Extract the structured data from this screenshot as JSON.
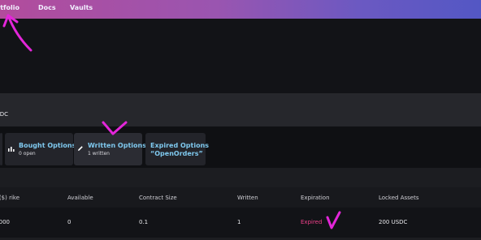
{
  "nav": {
    "portfolio": "Portfolio",
    "docs": "Docs",
    "vaults": "Vaults"
  },
  "account": {
    "text": "DC"
  },
  "tabs": [
    {
      "title": "Bought Options",
      "subtitle": "0 open",
      "icon": "bar-chart-icon"
    },
    {
      "title": "Written Options",
      "subtitle": "1 written",
      "icon": "pencil-icon"
    },
    {
      "title": "Expired Options",
      "subtitle": "“OpenOrders”"
    }
  ],
  "table": {
    "headers": [
      "rike ($)",
      "Available",
      "Contract Size",
      "Written",
      "Expiration",
      "Locked Assets"
    ],
    "rows": [
      {
        "strike": "000",
        "available": "0",
        "contract_size": "0.1",
        "written": "1",
        "expiration": "Expired",
        "locked_assets": "200 USDC"
      }
    ]
  },
  "colors": {
    "accent": "#7fc9ef",
    "expired": "#f0408a",
    "annotation": "#e326d9"
  }
}
